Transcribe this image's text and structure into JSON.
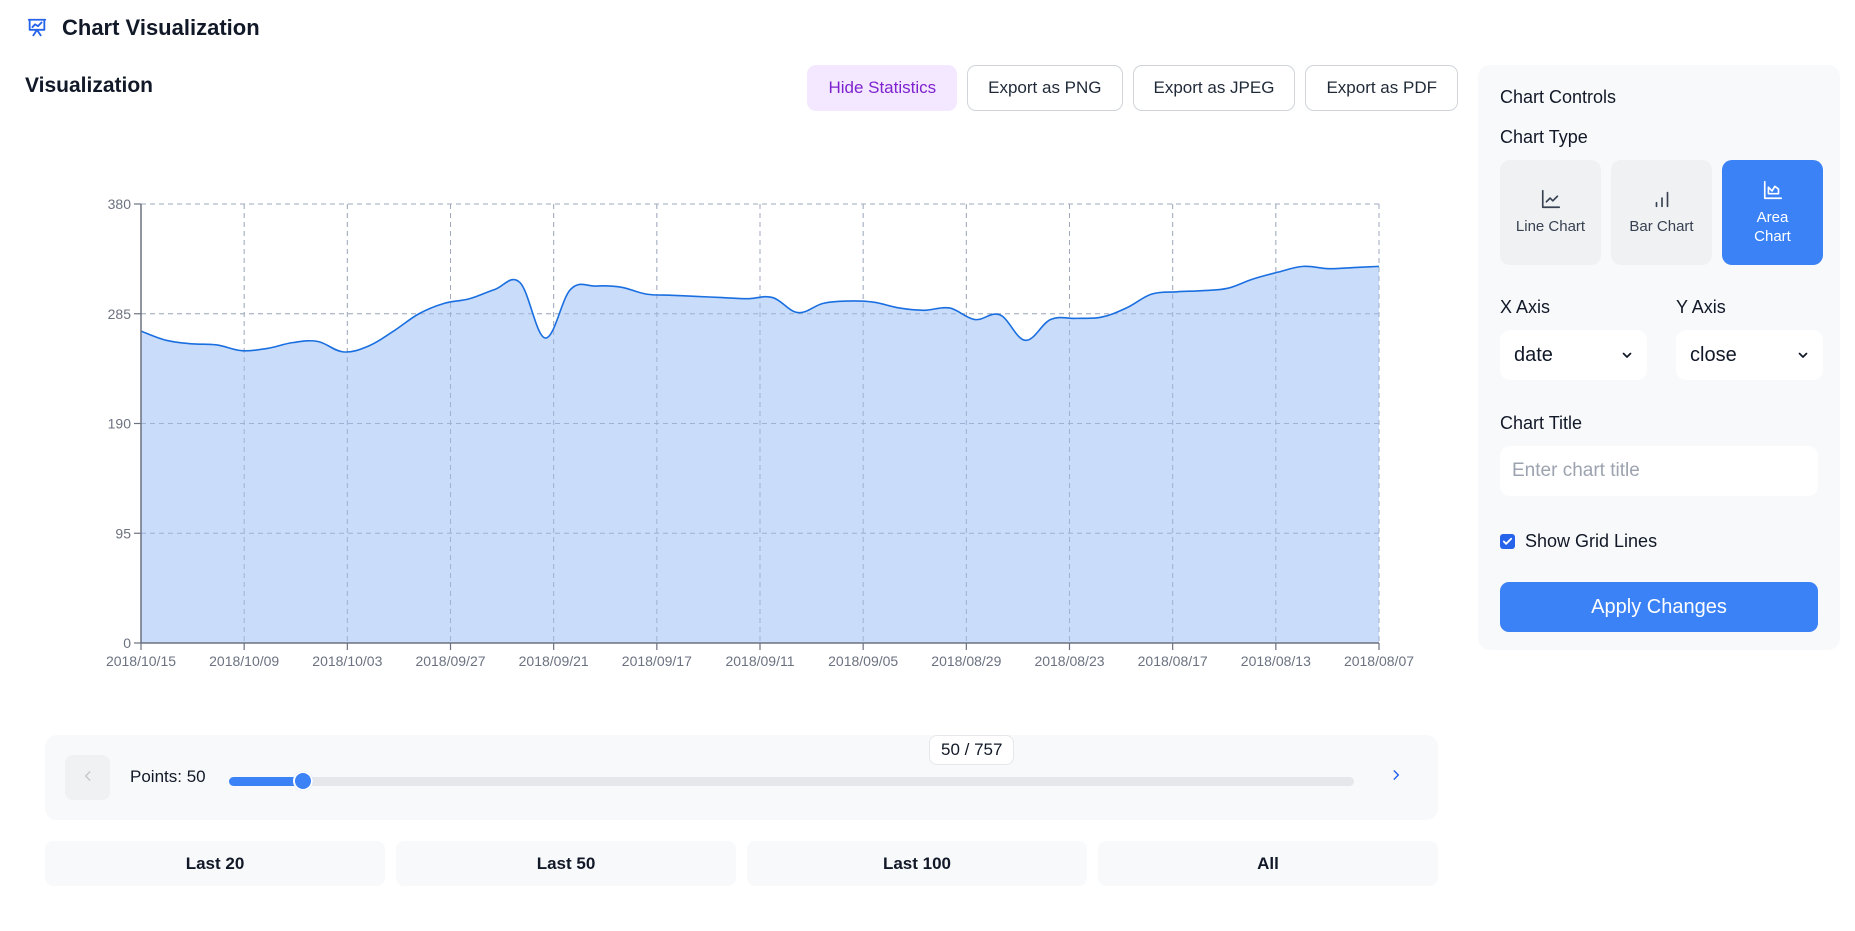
{
  "app": {
    "title": "Chart Visualization",
    "logo_icon": "presentation-chart-icon"
  },
  "main": {
    "section_title": "Visualization",
    "toolbar": {
      "hide_statistics": "Hide Statistics",
      "export_png": "Export as PNG",
      "export_jpeg": "Export as JPEG",
      "export_pdf": "Export as PDF"
    }
  },
  "chart_data": {
    "type": "area",
    "title": "",
    "xlabel": "",
    "ylabel": "",
    "series_field": "close",
    "x_field": "date",
    "ylim": [
      0,
      380
    ],
    "y_ticks": [
      0,
      95,
      190,
      285,
      380
    ],
    "x_tick_labels": [
      "2018/10/15",
      "2018/10/09",
      "2018/10/03",
      "2018/09/27",
      "2018/09/21",
      "2018/09/17",
      "2018/09/11",
      "2018/09/05",
      "2018/08/29",
      "2018/08/23",
      "2018/08/17",
      "2018/08/13",
      "2018/08/07"
    ],
    "grid": true,
    "colors": {
      "line": "#1a6fe0",
      "fill": "#c6dafa",
      "grid": "#c8c8c8",
      "axis": "#6b7280"
    },
    "values": [
      270,
      262,
      259,
      258,
      253,
      255,
      260,
      261,
      252,
      257,
      270,
      285,
      294,
      298,
      306,
      312,
      264,
      306,
      309,
      308,
      302,
      301,
      300,
      299,
      298,
      299,
      286,
      294,
      296,
      295,
      290,
      288,
      290,
      280,
      284,
      262,
      280,
      281,
      282,
      290,
      302,
      304,
      305,
      307,
      315,
      321,
      326,
      324,
      325,
      326
    ]
  },
  "slider": {
    "points_label": "Points: 50",
    "counter": "50 / 757",
    "current": 50,
    "total": 757,
    "prev_icon": "chevron-left-icon",
    "next_icon": "chevron-right-icon"
  },
  "quick_ranges": [
    "Last 20",
    "Last 50",
    "Last 100",
    "All"
  ],
  "controls": {
    "title": "Chart Controls",
    "chart_type_label": "Chart Type",
    "chart_types": [
      {
        "label": "Line Chart",
        "icon": "line-chart-icon",
        "active": false
      },
      {
        "label": "Bar Chart",
        "icon": "bar-chart-icon",
        "active": false
      },
      {
        "label": "Area Chart",
        "icon": "area-chart-icon",
        "active": true
      }
    ],
    "x_axis_label": "X Axis",
    "x_axis_value": "date",
    "y_axis_label": "Y Axis",
    "y_axis_value": "close",
    "chart_title_label": "Chart Title",
    "chart_title_placeholder": "Enter chart title",
    "chart_title_value": "",
    "show_grid_label": "Show Grid Lines",
    "show_grid_checked": true,
    "apply_label": "Apply Changes"
  }
}
